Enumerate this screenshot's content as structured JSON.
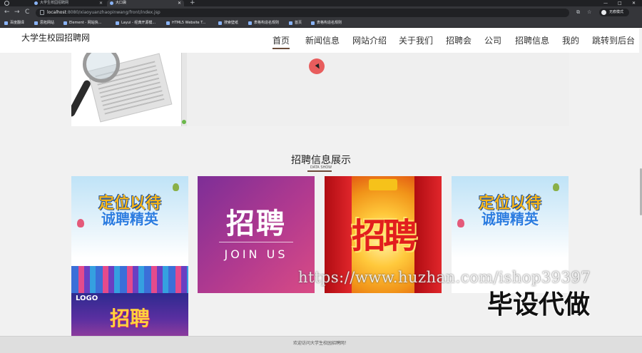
{
  "browser": {
    "tabs": [
      {
        "title": "大学生校园招聘网",
        "active": false
      },
      {
        "title": "大口袋",
        "active": true
      }
    ],
    "new_tab_symbol": "+",
    "window_controls": [
      "—",
      "□",
      "✕"
    ],
    "nav_buttons": [
      "←",
      "→",
      "C"
    ],
    "url_host": "localhost",
    "url_path": ":8080/xiaoyuanzhaopinwang/front/index.jsp",
    "profile_label": "无痕模式",
    "toolbar_icons": [
      "⧉",
      "☆"
    ],
    "bookmarks": [
      "百度翻译",
      "思拓网站",
      "Element - 网站快...",
      "Layui - 经典开源模...",
      "HTML5 Website T...",
      "搜索壁纸",
      "表格构造名规则",
      "首页",
      "表格构造名规则"
    ]
  },
  "site": {
    "title": "大学生校园招聘网",
    "nav": [
      {
        "label": "首页",
        "active": true
      },
      {
        "label": "新闻信息",
        "active": false
      },
      {
        "label": "网站介绍",
        "active": false
      },
      {
        "label": "关于我们",
        "active": false
      },
      {
        "label": "招聘会",
        "active": false
      },
      {
        "label": "公司",
        "active": false
      },
      {
        "label": "招聘信息",
        "active": false
      },
      {
        "label": "我的",
        "active": false
      },
      {
        "label": "跳转到后台",
        "active": false
      }
    ]
  },
  "section": {
    "title": "招聘信息展示",
    "subtitle": "DATA SHOW"
  },
  "cards": [
    {
      "line1": "定位以待",
      "line2": "诚聘精英"
    },
    {
      "line1": "招聘",
      "line2": "JOIN US"
    },
    {
      "line1": "招聘"
    },
    {
      "line1": "定位以待",
      "line2": "诚聘精英"
    },
    {
      "logo": "LOGO",
      "line1": "招聘"
    }
  ],
  "watermark": {
    "url": "https://www.huzhan.com/ishop39397",
    "text": "毕设代做"
  },
  "footer": {
    "text": "欢迎访问大学生校园招聘网！"
  },
  "colors": {
    "nav_underline": "#6a4b3a",
    "page_background": "#f1f1f1",
    "browser_dark": "#202124"
  }
}
